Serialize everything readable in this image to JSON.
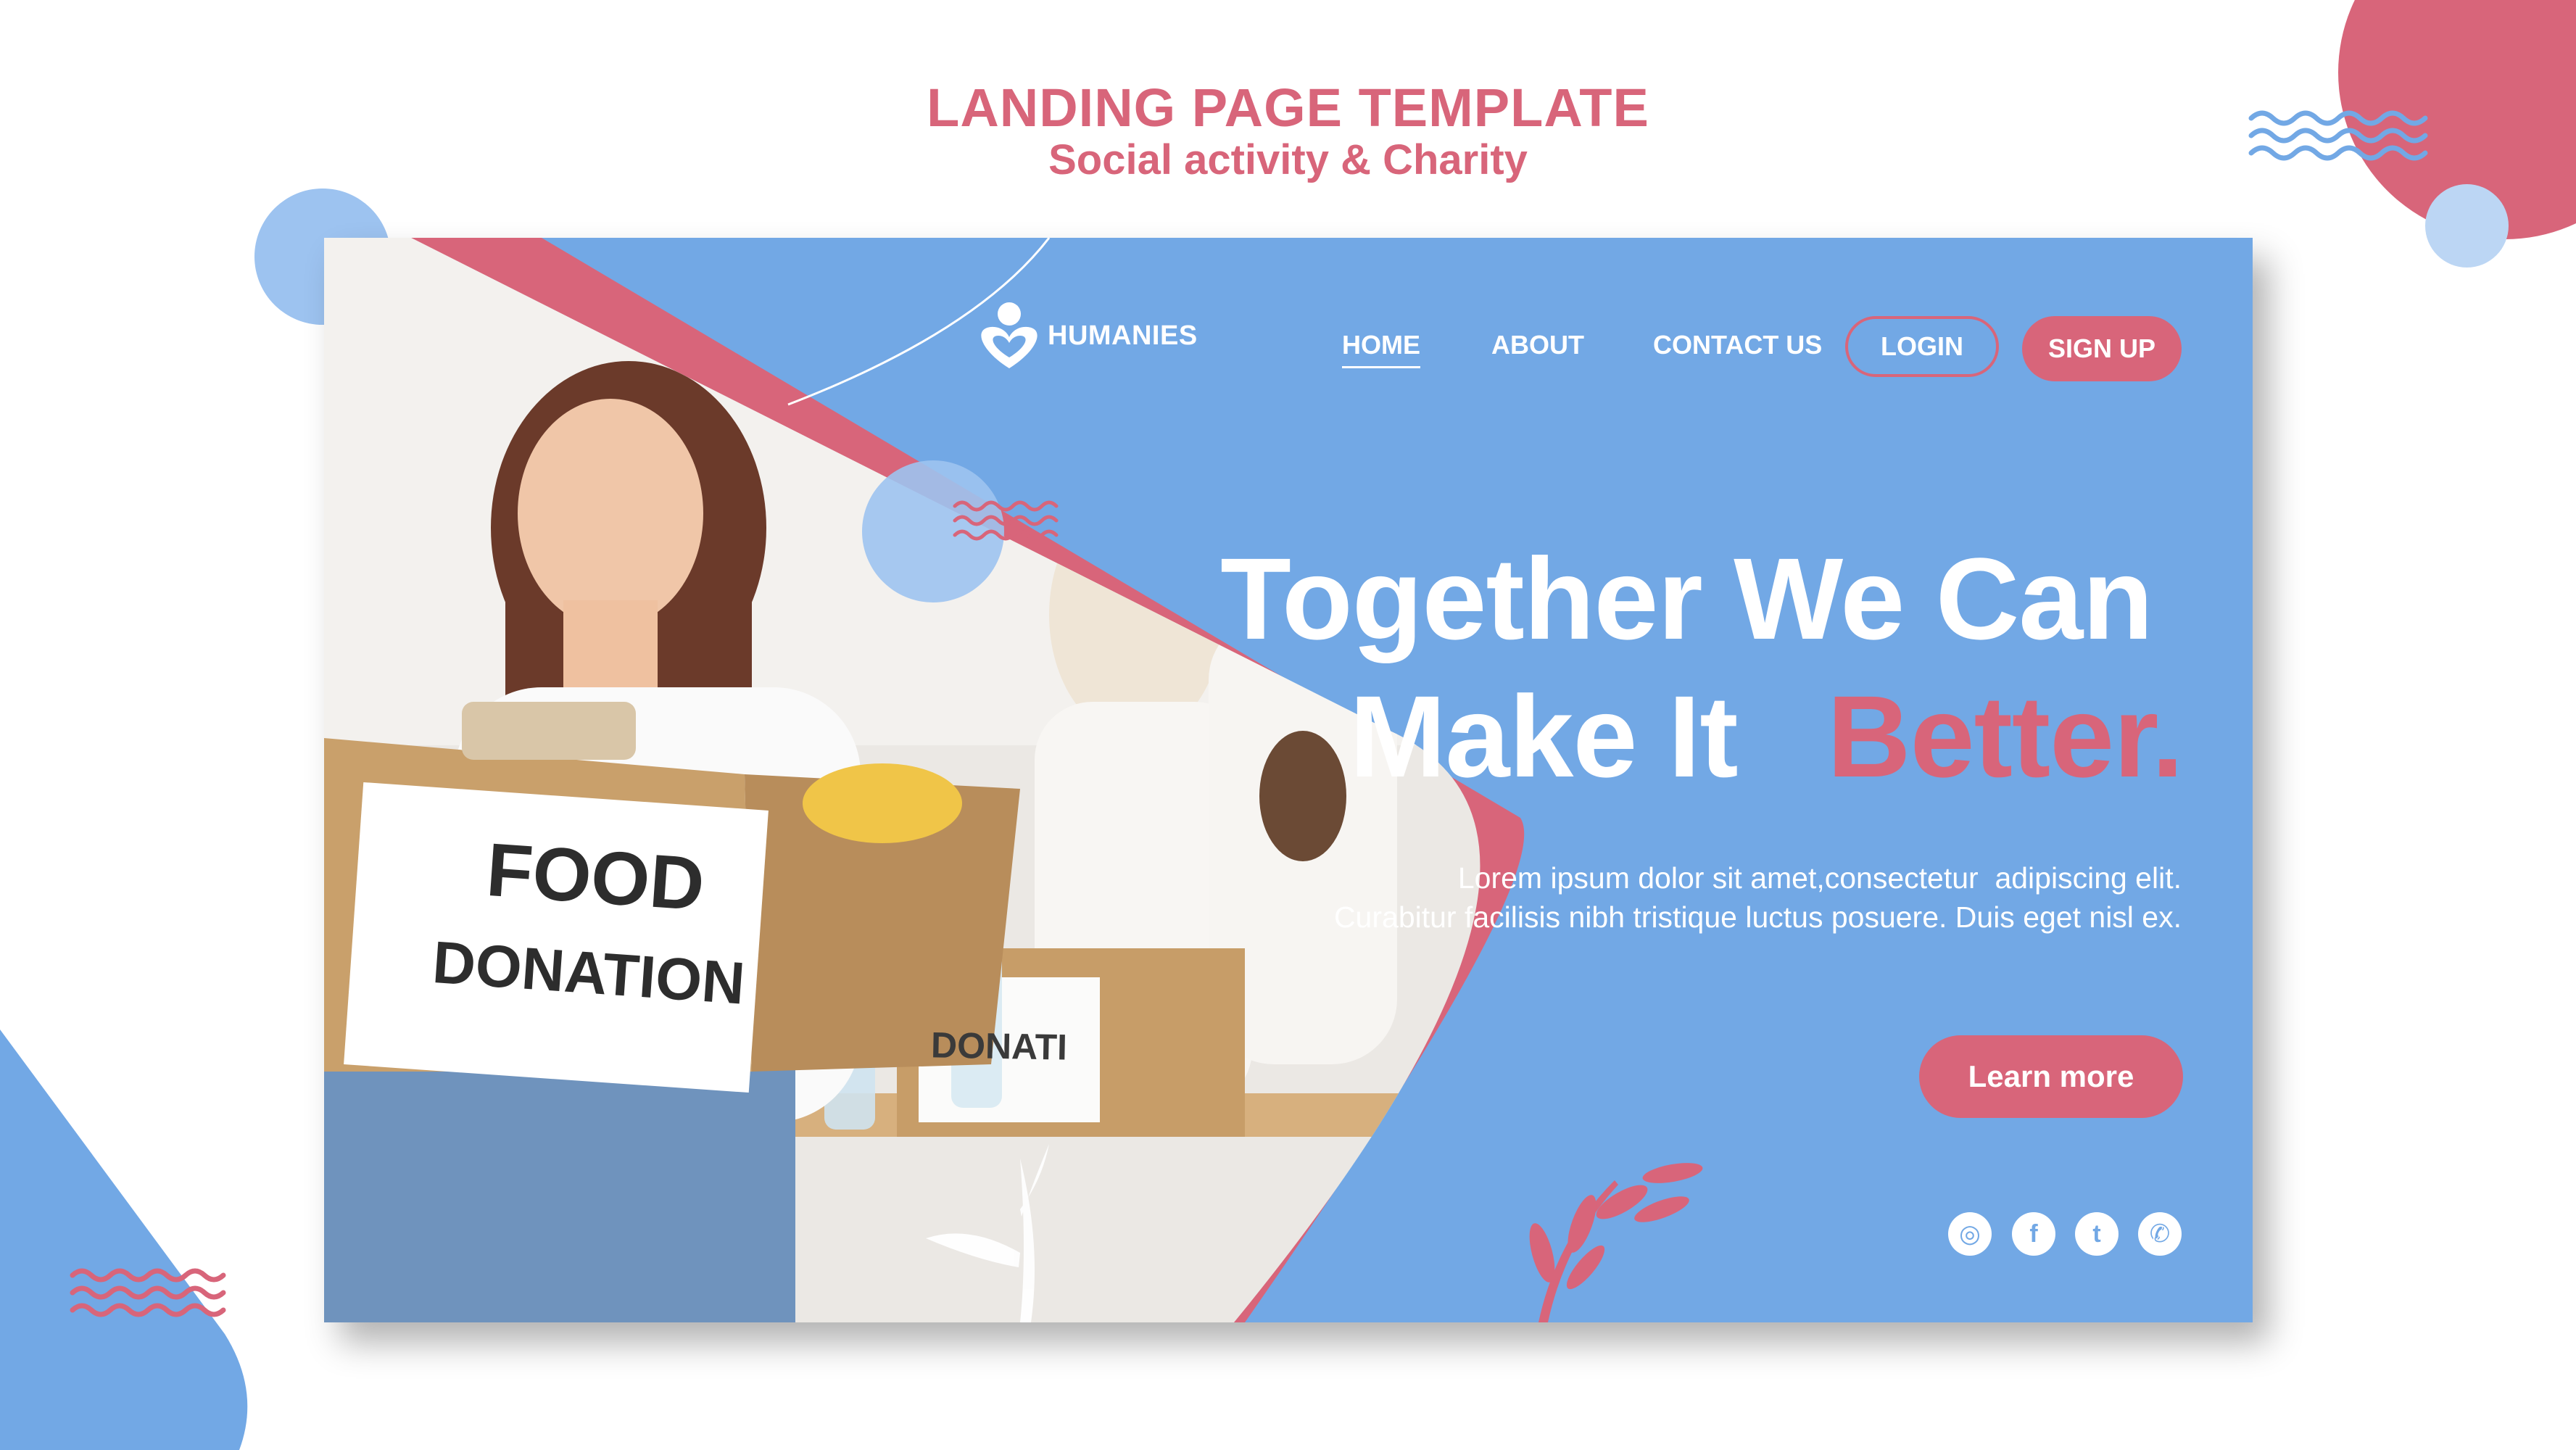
{
  "header": {
    "title": "LANDING PAGE TEMPLATE",
    "subtitle": "Social activity & Charity"
  },
  "colors": {
    "accent_pink": "#d8657a",
    "card_blue": "#72a8e5",
    "light_blue": "#9dc3f0",
    "pale_blue": "#bcd6f4",
    "white": "#ffffff"
  },
  "brand": {
    "name": "HUMANIES",
    "icon": "heart-person-icon"
  },
  "nav": {
    "items": [
      {
        "label": "HOME",
        "active": true
      },
      {
        "label": "ABOUT",
        "active": false
      },
      {
        "label": "CONTACT US",
        "active": false
      }
    ],
    "login_label": "LOGIN",
    "signup_label": "SIGN UP"
  },
  "hero": {
    "line1": "Together We Can",
    "line2_part1": "Make It",
    "line2_highlight": "Better.",
    "description_line1": "Lorem ipsum dolor sit amet,consectetur  adipiscing elit.",
    "description_line2": "Curabitur facilisis nibh tristique luctus posuere. Duis eget nisl ex.",
    "cta_label": "Learn more"
  },
  "photo": {
    "box_sign_line1": "FOOD",
    "box_sign_line2": "DONATION",
    "back_box_sign": "DONATI"
  },
  "social": [
    {
      "icon": "instagram-icon",
      "glyph": "◎"
    },
    {
      "icon": "facebook-icon",
      "glyph": "f"
    },
    {
      "icon": "twitter-icon",
      "glyph": "t"
    },
    {
      "icon": "whatsapp-icon",
      "glyph": "✆"
    }
  ]
}
